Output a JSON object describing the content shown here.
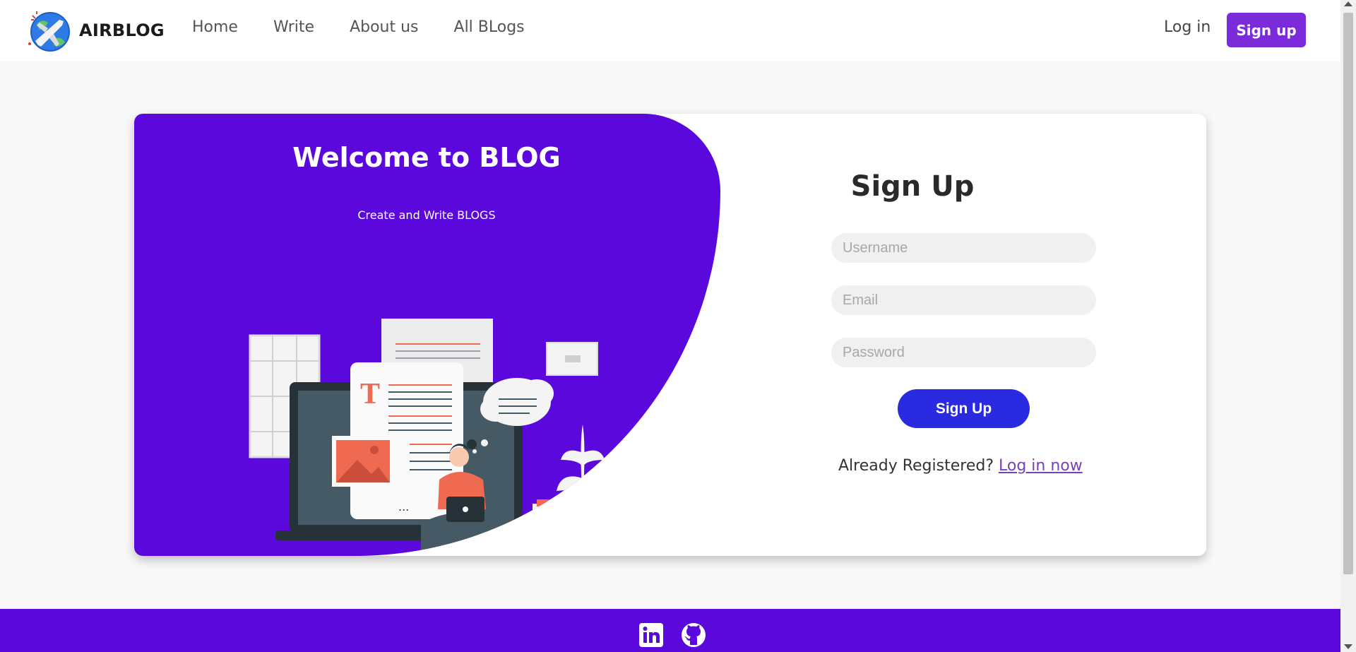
{
  "brand": {
    "name": "AIRBLOG",
    "logo_icon": "airplane-globe-icon"
  },
  "nav": {
    "links": [
      "Home",
      "Write",
      "About us",
      "All BLogs"
    ],
    "login_label": "Log in",
    "signup_label": "Sign up"
  },
  "welcome": {
    "title": "Welcome to BLOG",
    "subtitle": "Create and Write BLOGS",
    "illustration": "person-blogging-on-laptop-illustration"
  },
  "form": {
    "title": "Sign Up",
    "username_placeholder": "Username",
    "email_placeholder": "Email",
    "password_placeholder": "Password",
    "submit_label": "Sign Up",
    "already_text": "Already Registered?",
    "login_now_label": "Log in now"
  },
  "footer": {
    "icons": [
      "linkedin-icon",
      "github-icon"
    ]
  },
  "colors": {
    "primary_purple": "#5b08dc",
    "signup_button": "#7b2bd9",
    "submit_button": "#2a2ae0",
    "link": "#7b3fb8"
  }
}
